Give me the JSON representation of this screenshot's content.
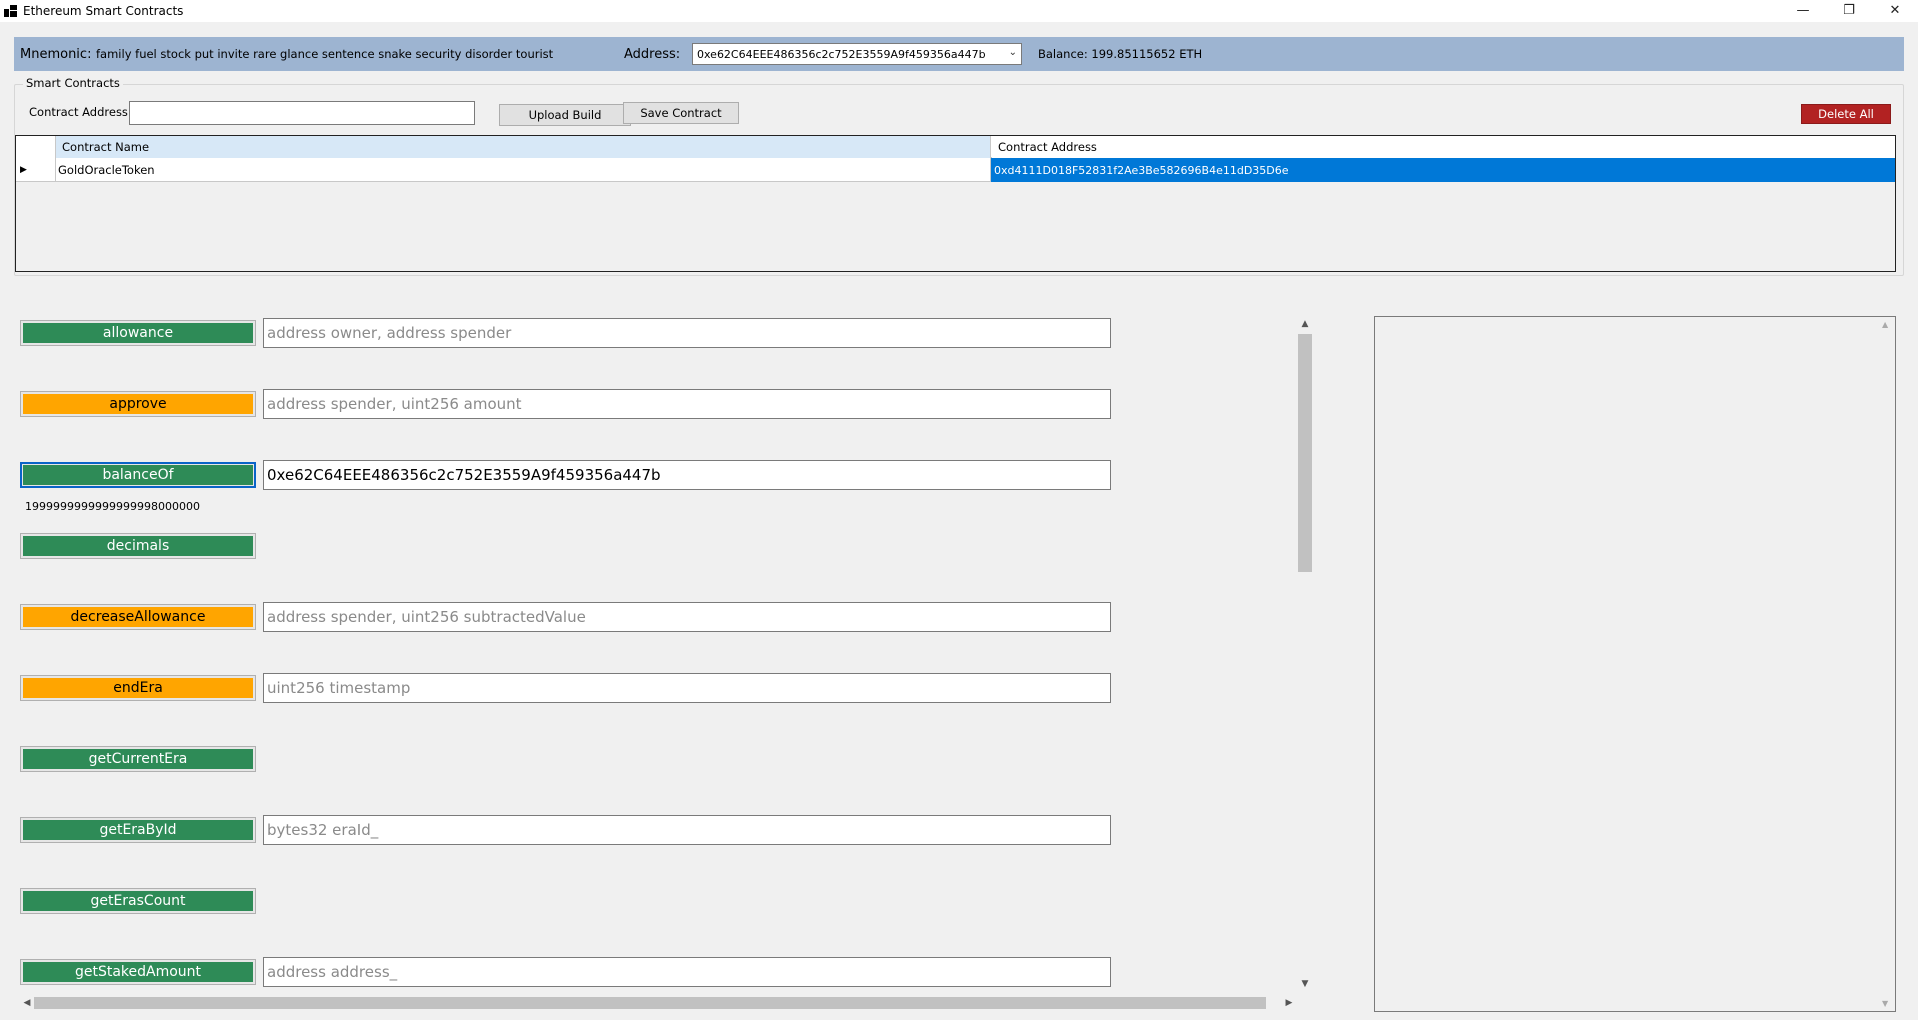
{
  "window": {
    "title": "Ethereum Smart Contracts",
    "minimize_glyph": "—",
    "restore_glyph": "❐",
    "close_glyph": "✕"
  },
  "header": {
    "mnemonic_label": "Mnemonic:",
    "mnemonic_value": "family fuel stock put invite rare glance sentence snake security disorder tourist",
    "address_label": "Address:",
    "address_value": "0xe62C64EEE486356c2c752E3559A9f459356a447b",
    "balance": "Balance: 199.85115652 ETH"
  },
  "contracts": {
    "group_title": "Smart Contracts",
    "address_label": "Contract Address",
    "address_value": "",
    "upload_label": "Upload Build",
    "save_label": "Save Contract",
    "delete_label": "Delete All",
    "columns": [
      "Contract Name",
      "Contract Address"
    ],
    "rows": [
      {
        "name": "GoldOracleToken",
        "address": "0xd4111D018F52831f2Ae3Be582696B4e11dD35D6e"
      }
    ]
  },
  "functions": [
    {
      "name": "allowance",
      "kind": "call",
      "placeholder": "address owner, address spender",
      "value": ""
    },
    {
      "name": "approve",
      "kind": "send",
      "placeholder": "address spender, uint256 amount",
      "value": ""
    },
    {
      "name": "balanceOf",
      "kind": "call",
      "placeholder": "",
      "value": "0xe62C64EEE486356c2c752E3559A9f459356a447b",
      "result": "1999999999999999998000000"
    },
    {
      "name": "decimals",
      "kind": "call"
    },
    {
      "name": "decreaseAllowance",
      "kind": "send",
      "placeholder": "address spender, uint256 subtractedValue",
      "value": ""
    },
    {
      "name": "endEra",
      "kind": "send",
      "placeholder": "uint256 timestamp",
      "value": ""
    },
    {
      "name": "getCurrentEra",
      "kind": "call"
    },
    {
      "name": "getEraById",
      "kind": "call",
      "placeholder": "bytes32 eraId_",
      "value": ""
    },
    {
      "name": "getErasCount",
      "kind": "call"
    },
    {
      "name": "getStakedAmount",
      "kind": "call",
      "placeholder": "address address_",
      "value": ""
    }
  ],
  "colors": {
    "call": "#2e8b57",
    "send": "#ffa500",
    "selection": "#0078d7",
    "delete": "#b22222",
    "header_bar": "#9db4d1"
  }
}
